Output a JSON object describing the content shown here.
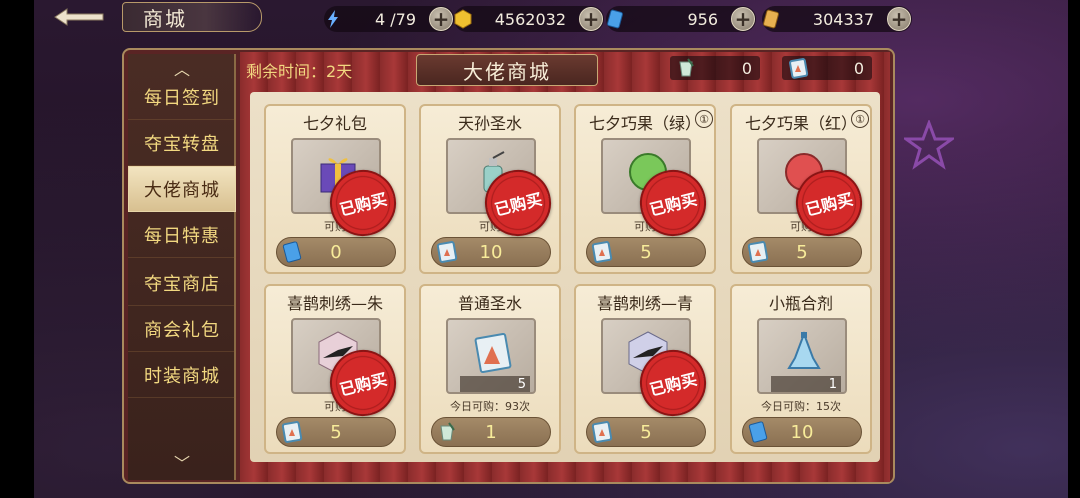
{
  "header": {
    "back_icon": "back-arrow-icon",
    "title": "商城",
    "resources": [
      {
        "icon": "stamina-lightning-icon",
        "value": "4 /79"
      },
      {
        "icon": "gold-coin-icon",
        "value": "4562032"
      },
      {
        "icon": "blue-ticket-icon",
        "value": "956"
      },
      {
        "icon": "gold-ticket-icon",
        "value": "304337"
      }
    ]
  },
  "sidebar": {
    "items": [
      {
        "label": "每日签到"
      },
      {
        "label": "夺宝转盘"
      },
      {
        "label": "大佬商城"
      },
      {
        "label": "每日特惠"
      },
      {
        "label": "夺宝商店"
      },
      {
        "label": "商会礼包"
      },
      {
        "label": "时装商城"
      }
    ],
    "active_index": 2
  },
  "shop": {
    "title": "大佬商城",
    "timer_label": "剩余时间：",
    "timer_value": "2天",
    "currencies": [
      {
        "icon": "holy-water-cup-icon",
        "value": "0"
      },
      {
        "icon": "voucher-card-icon",
        "value": "0"
      }
    ],
    "purchased_label": "已购买",
    "items": [
      {
        "name": "七夕礼包",
        "info": "",
        "qty": "",
        "limit": "可购",
        "price": "0",
        "price_icon": "blue-card-icon",
        "purchased": true,
        "art": "gift-box-icon"
      },
      {
        "name": "天孙圣水",
        "info": "",
        "qty": "",
        "limit": "可购",
        "price": "10",
        "price_icon": "voucher-card-icon",
        "purchased": true,
        "art": "perfume-bottle-icon"
      },
      {
        "name": "七夕巧果（绿）",
        "info": "①",
        "qty": "",
        "limit": "可购",
        "price": "5",
        "price_icon": "voucher-card-icon",
        "purchased": true,
        "art": "green-cookie-icon"
      },
      {
        "name": "七夕巧果（红）",
        "info": "①",
        "qty": "",
        "limit": "可购",
        "price": "5",
        "price_icon": "voucher-card-icon",
        "purchased": true,
        "art": "red-cookie-icon"
      },
      {
        "name": "喜鹊刺绣—朱",
        "info": "",
        "qty": "",
        "limit": "可购",
        "price": "5",
        "price_icon": "voucher-card-icon",
        "purchased": true,
        "art": "magpie-embroidery-icon"
      },
      {
        "name": "普通圣水",
        "info": "",
        "qty": "5",
        "limit": "今日可购：93次",
        "price": "1",
        "price_icon": "holy-water-cup-icon",
        "purchased": false,
        "art": "holy-water-icon"
      },
      {
        "name": "喜鹊刺绣—青",
        "info": "",
        "qty": "",
        "limit": "",
        "price": "5",
        "price_icon": "voucher-card-icon",
        "purchased": true,
        "art": "magpie-embroidery-blue-icon"
      },
      {
        "name": "小瓶合剂",
        "info": "",
        "qty": "1",
        "limit": "今日可购：15次",
        "price": "10",
        "price_icon": "blue-card-icon",
        "purchased": false,
        "art": "small-potion-icon"
      }
    ]
  }
}
